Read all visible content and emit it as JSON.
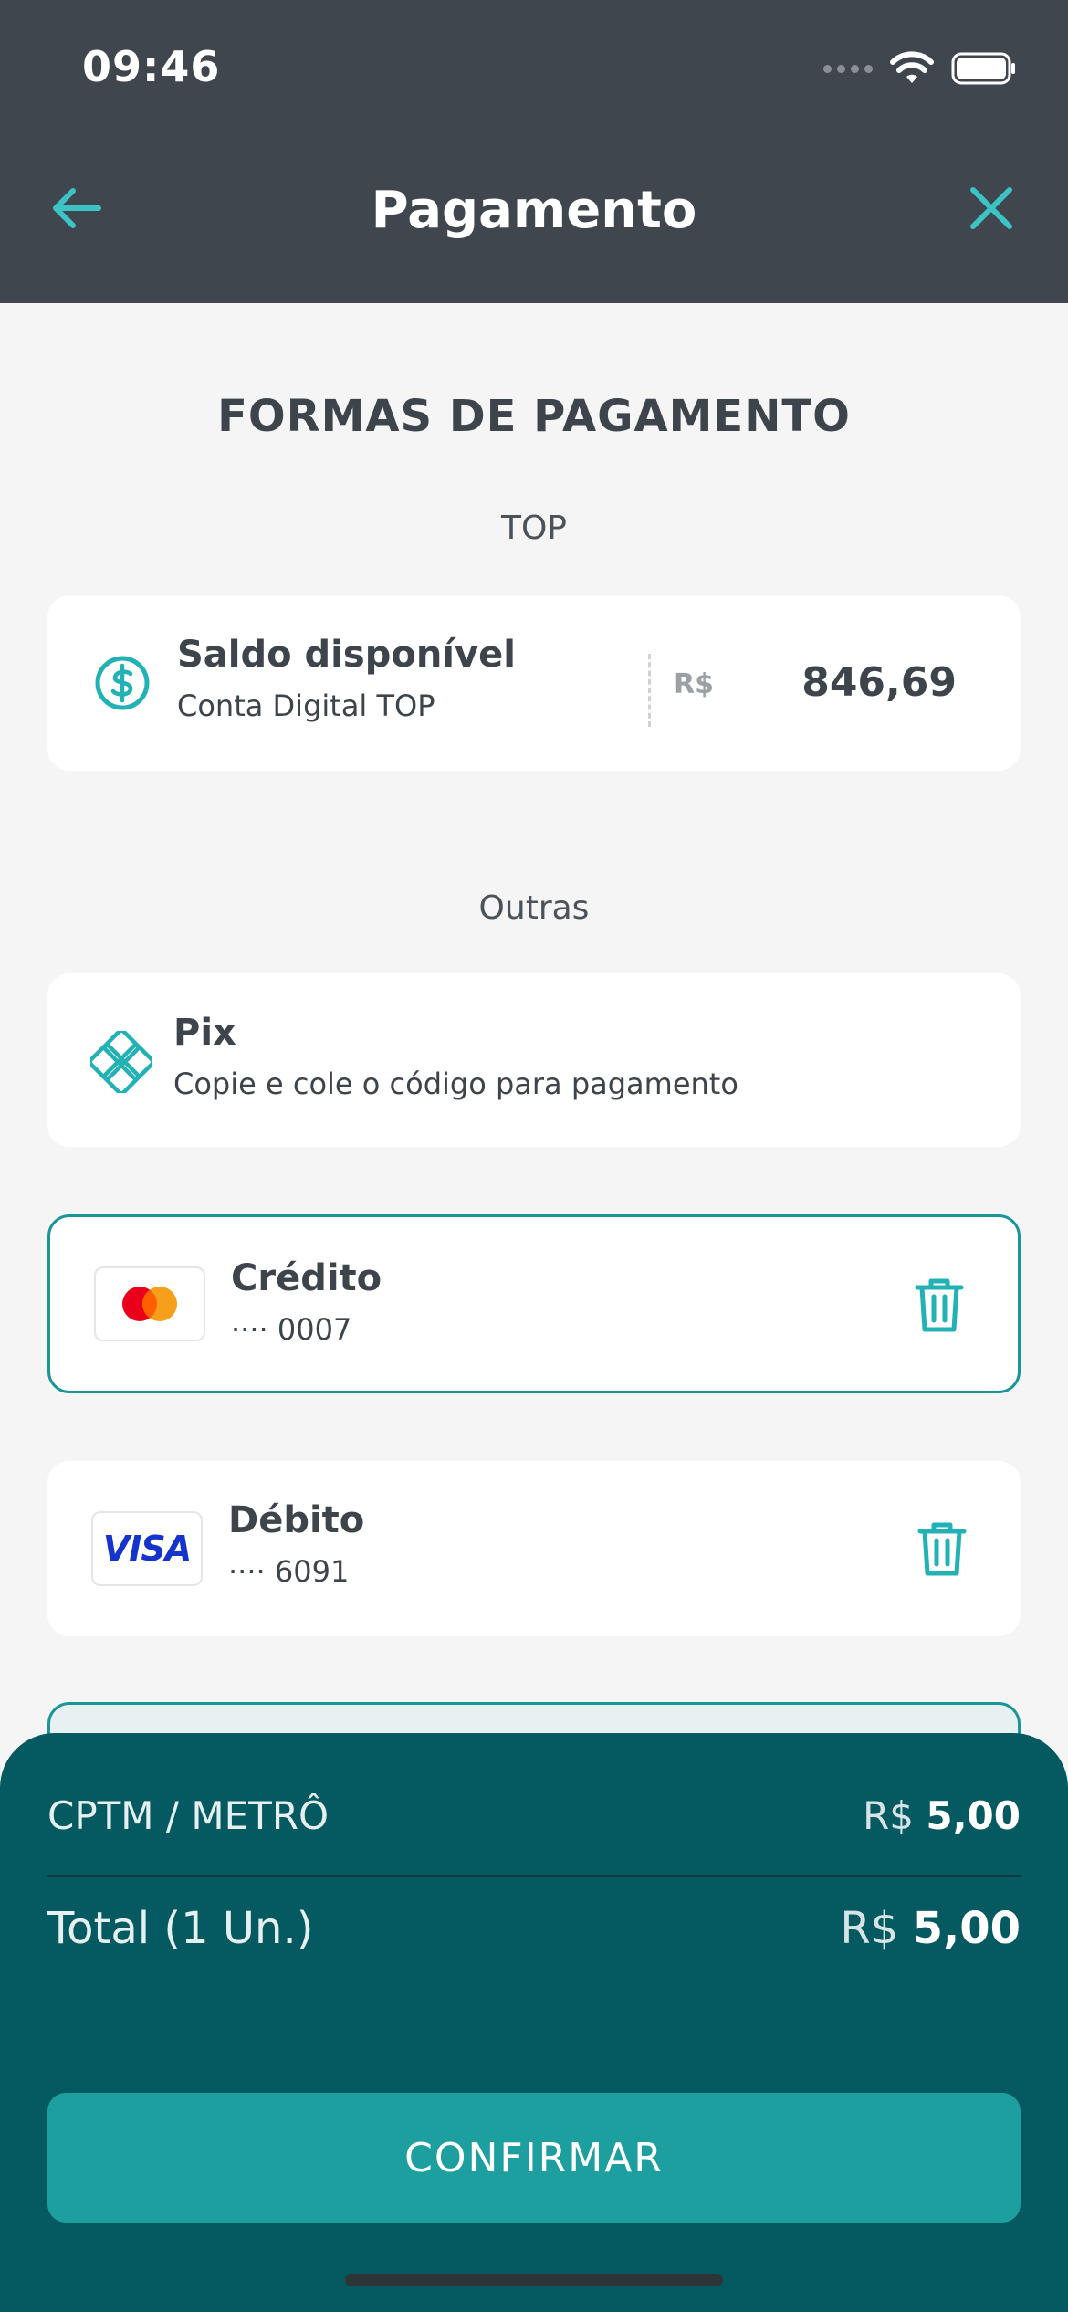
{
  "status_bar": {
    "time": "09:46"
  },
  "header": {
    "title": "Pagamento"
  },
  "section_title": "FORMAS DE PAGAMENTO",
  "top_group": {
    "label": "TOP",
    "balance_card": {
      "title": "Saldo disponível",
      "subtitle": "Conta Digital TOP",
      "currency": "R$",
      "amount": "846,69"
    }
  },
  "other_group": {
    "label": "Outras",
    "pix": {
      "title": "Pix",
      "subtitle": "Copie e cole o código para pagamento"
    },
    "credit": {
      "title": "Crédito",
      "subtitle": "···· 0007",
      "brand": "mastercard-icon"
    },
    "debit": {
      "title": "Débito",
      "subtitle": "···· 6091",
      "brand": "visa-icon",
      "brand_text": "VISA"
    }
  },
  "summary": {
    "item_label": "CPTM / METRÔ",
    "item_currency": "R$",
    "item_value": "5,00",
    "total_label": "Total (1 Un.)",
    "total_currency": "R$",
    "total_value": "5,00",
    "confirm_label": "CONFIRMAR"
  },
  "colors": {
    "header_bg": "#3f464d",
    "accent": "#1b9598",
    "sheet_bg": "#055a61",
    "confirm_bg": "#1d9fa0"
  }
}
